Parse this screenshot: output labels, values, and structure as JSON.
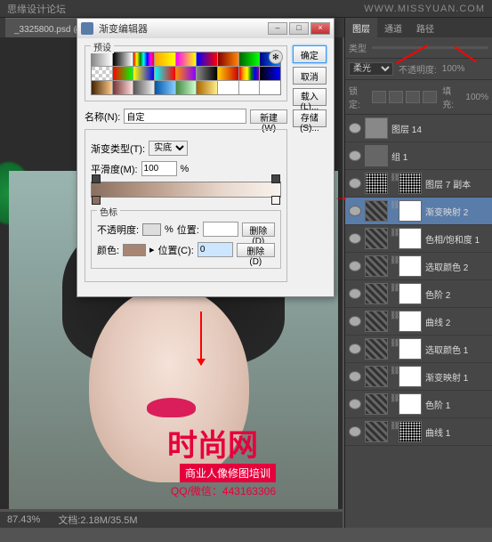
{
  "header": {
    "forum": "思缘设计论坛",
    "watermark": "WWW.MISSYUAN.COM"
  },
  "tab": {
    "label": "_3325800.psd @ 87.4% (渐变映射 2, 图层蒙版/8) *"
  },
  "dialog": {
    "title": "渐变编辑器",
    "presets_label": "预设",
    "ok": "确定",
    "cancel": "取消",
    "load": "载入(L)...",
    "save": "存储(S)...",
    "name_label": "名称(N):",
    "name_value": "自定",
    "new_btn": "新建(W)",
    "gradtype_label": "渐变类型(T):",
    "gradtype_value": "实底",
    "smooth_label": "平滑度(M):",
    "smooth_value": "100",
    "smooth_unit": "%",
    "stops_label": "色标",
    "opacity_label": "不透明度:",
    "opacity_unit": "%",
    "pos1_label": "位置:",
    "del1": "删除(D)",
    "color_label": "颜色:",
    "pos2_label": "位置(C):",
    "pos2_value": "0",
    "del2": "删除(D)"
  },
  "swatches": [
    "linear-gradient(90deg,#888,#fff)",
    "linear-gradient(90deg,#000,#fff)",
    "linear-gradient(90deg,red,yellow,green,cyan,blue,magenta,red)",
    "linear-gradient(90deg,orange,yellow)",
    "linear-gradient(90deg,#f0f,#ff0)",
    "linear-gradient(90deg,#00f,#f00)",
    "linear-gradient(90deg,#800,#f80)",
    "linear-gradient(90deg,#060,#0f0)",
    "linear-gradient(90deg,#008,#08f)",
    "tr",
    "linear-gradient(90deg,#f00,#0f0)",
    "linear-gradient(90deg,#ff0,#00f)",
    "linear-gradient(90deg,#0ff,#f00)",
    "linear-gradient(90deg,#f80,#80f)",
    "linear-gradient(90deg,#888,#000)",
    "linear-gradient(90deg,#fc0,#c00)",
    "linear-gradient(90deg,red,orange,yellow,green,blue,purple)",
    "linear-gradient(90deg,#000,#00f)",
    "linear-gradient(90deg,#420,#fc8)",
    "linear-gradient(90deg,#733,#fdd)",
    "linear-gradient(90deg,#555,#eee)",
    "linear-gradient(90deg,#05a,#8cf)",
    "linear-gradient(90deg,#484,#cfc)",
    "linear-gradient(90deg,#a60,#fe8)",
    "linear-gradient(90deg,#fff,#fff)",
    "linear-gradient(90deg,#fff,#fff)",
    "linear-gradient(90deg,#fff,#fff)"
  ],
  "panels": {
    "tabs": [
      "图层",
      "通道",
      "路径"
    ],
    "blend_label": "类型",
    "opacity_label": "不透明度:",
    "opacity_val": "100%",
    "lock_label": "锁定:",
    "fill_label": "填充:",
    "fill_val": "100%"
  },
  "layers": [
    {
      "name": "图层 14",
      "thumb": "tr",
      "mask": false
    },
    {
      "name": "组 1",
      "thumb": "folder",
      "mask": false,
      "folder": true
    },
    {
      "name": "图层 7 副本",
      "thumb": "noise",
      "mask": true,
      "mask_style": "noise"
    },
    {
      "name": "渐变映射 2",
      "thumb": "stripes",
      "mask": true,
      "sel": true
    },
    {
      "name": "色相/饱和度 1",
      "thumb": "stripes",
      "mask": true
    },
    {
      "name": "选取颜色 2",
      "thumb": "stripes",
      "mask": true
    },
    {
      "name": "色阶 2",
      "thumb": "stripes",
      "mask": true
    },
    {
      "name": "曲线 2",
      "thumb": "stripes",
      "mask": true
    },
    {
      "name": "选取颜色 1",
      "thumb": "stripes",
      "mask": true
    },
    {
      "name": "渐变映射 1",
      "thumb": "stripes",
      "mask": true
    },
    {
      "name": "色阶 1",
      "thumb": "stripes",
      "mask": true
    },
    {
      "name": "曲线 1",
      "thumb": "stripes",
      "mask": true,
      "mask_style": "noise"
    }
  ],
  "status": {
    "zoom": "87.43%",
    "docinfo": "文档:2.18M/35.5M"
  },
  "brand": {
    "logo": "时尚网",
    "sub": "商业人像修图培训",
    "qq": "QQ/微信：443163306"
  }
}
